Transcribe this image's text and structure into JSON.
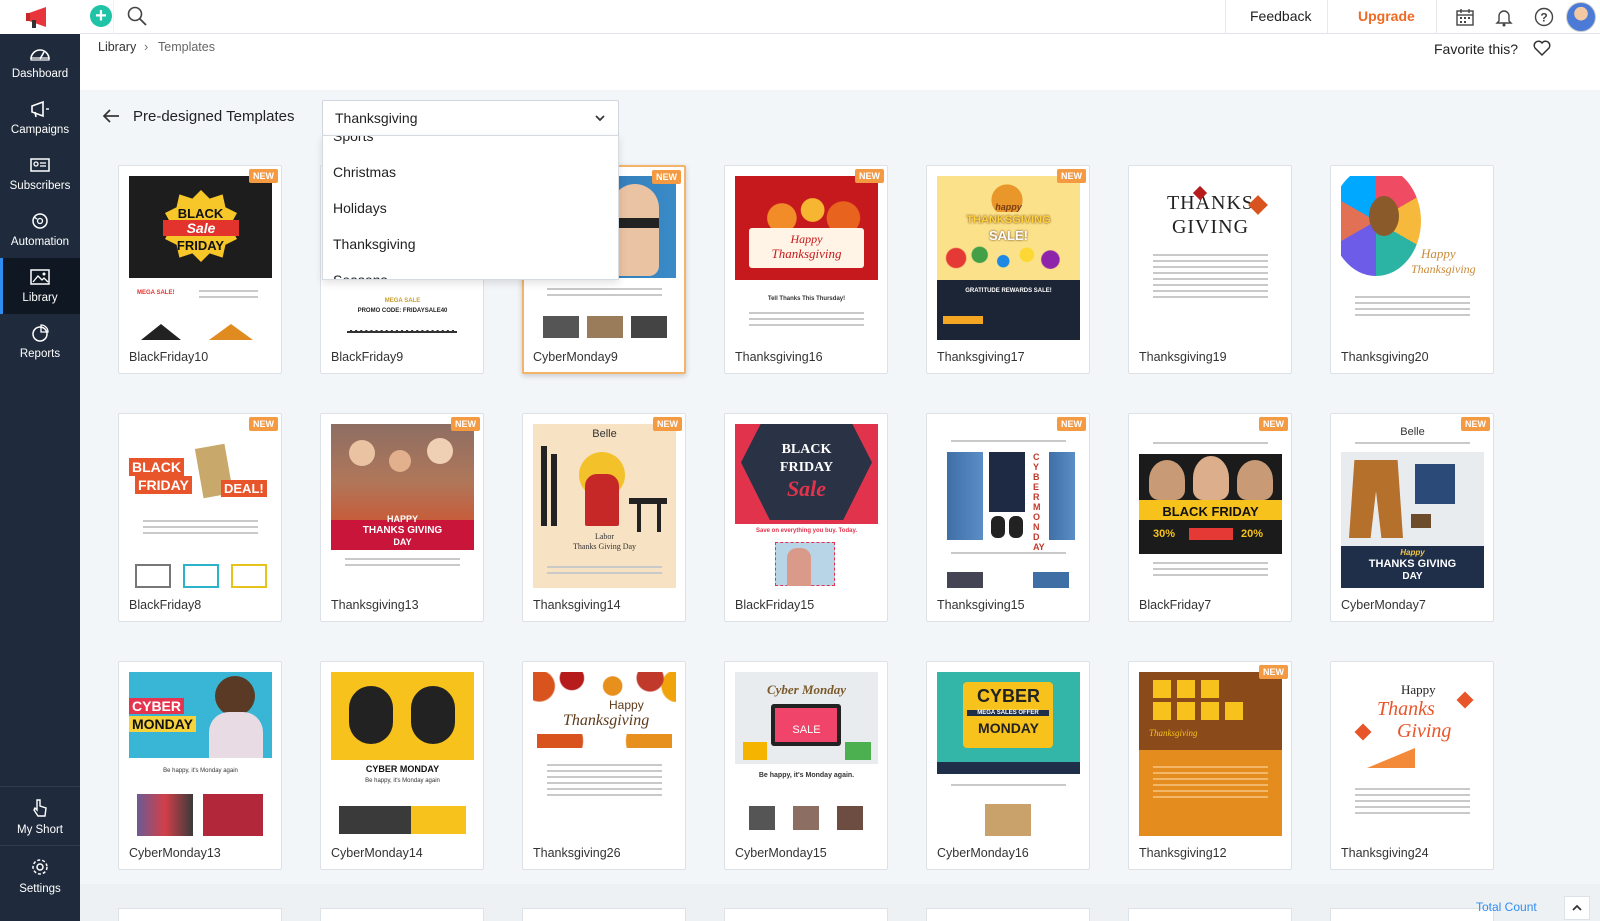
{
  "topbar": {
    "feedback": "Feedback",
    "upgrade": "Upgrade",
    "brand_color": "#e8353b",
    "plus_color": "#20c3a6",
    "accent_color": "#f06a23"
  },
  "sidebar": {
    "items": [
      {
        "label": "Dashboard",
        "icon": "gauge-icon"
      },
      {
        "label": "Campaigns",
        "icon": "megaphone-icon"
      },
      {
        "label": "Subscribers",
        "icon": "id-card-icon"
      },
      {
        "label": "Automation",
        "icon": "automation-icon"
      },
      {
        "label": "Library",
        "icon": "image-icon",
        "active": true
      },
      {
        "label": "Reports",
        "icon": "pie-chart-icon"
      }
    ],
    "bottom": [
      {
        "label": "My Short",
        "icon": "pointer-icon"
      },
      {
        "label": "Settings",
        "icon": "gear-icon"
      }
    ]
  },
  "breadcrumb": {
    "library": "Library",
    "separator": "›",
    "current": "Templates"
  },
  "favorite": "Favorite this?",
  "header": {
    "title": "Pre-designed Templates"
  },
  "dropdown": {
    "value": "Thanksgiving",
    "options": [
      "Sports",
      "Christmas",
      "Holidays",
      "Thanksgiving",
      "Seasons"
    ]
  },
  "badge": "NEW",
  "cards": [
    {
      "name": "BlackFriday10",
      "new": true
    },
    {
      "name": "BlackFriday9",
      "new": false
    },
    {
      "name": "CyberMonday9",
      "new": true
    },
    {
      "name": "Thanksgiving16",
      "new": true
    },
    {
      "name": "Thanksgiving17",
      "new": true
    },
    {
      "name": "Thanksgiving19",
      "new": false
    },
    {
      "name": "Thanksgiving20",
      "new": false
    },
    {
      "name": "BlackFriday8",
      "new": true
    },
    {
      "name": "Thanksgiving13",
      "new": true
    },
    {
      "name": "Thanksgiving14",
      "new": true
    },
    {
      "name": "BlackFriday15",
      "new": false
    },
    {
      "name": "Thanksgiving15",
      "new": true
    },
    {
      "name": "BlackFriday7",
      "new": true
    },
    {
      "name": "CyberMonday7",
      "new": true
    },
    {
      "name": "CyberMonday13",
      "new": false
    },
    {
      "name": "CyberMonday14",
      "new": false
    },
    {
      "name": "Thanksgiving26",
      "new": false
    },
    {
      "name": "CyberMonday15",
      "new": false
    },
    {
      "name": "CyberMonday16",
      "new": false
    },
    {
      "name": "Thanksgiving12",
      "new": true
    },
    {
      "name": "Thanksgiving24",
      "new": false
    }
  ],
  "thumbs": {
    "bf10": {
      "l1": "BLACK",
      "l2": "Sale",
      "l3": "FRIDAY",
      "sub": "MEGA SALE!"
    },
    "bf9": {
      "l1": "MEGA SALE",
      "l2": "PROMO CODE: FRIDAYSALE40"
    },
    "tg16": {
      "l1": "Happy",
      "l2": "Thanksgiving",
      "l3": "Tell Thanks This Thursday!"
    },
    "tg17": {
      "l1": "happy",
      "l2": "THANKSGIVING",
      "l3": "SALE!",
      "l4": "GRATITUDE REWARDS SALE!"
    },
    "tg19": {
      "l1": "THANKS",
      "l2": "GIVING"
    },
    "tg20": {
      "l1": "Happy",
      "l2": "Thanksgiving"
    },
    "bf8": {
      "l1": "BLACK",
      "l2": "FRIDAY",
      "l3": "DEAL!"
    },
    "tg13": {
      "l1": "HAPPY",
      "l2": "THANKS GIVING",
      "l3": "DAY"
    },
    "tg14": {
      "l1": "Belle",
      "l2": "Labor",
      "l3": "Thanks Giving Day"
    },
    "bf15": {
      "l1": "BLACK",
      "l2": "FRIDAY",
      "l3": "Sale",
      "l4": "Save on everything you buy. Today."
    },
    "tg15": {
      "l1": "CYBER MONDAY"
    },
    "bf7": {
      "l1": "BLACK FRIDAY",
      "l2": "30%",
      "l3": "20%"
    },
    "cm7": {
      "l1": "Belle",
      "l2": "Happy",
      "l3": "THANKS GIVING",
      "l4": "DAY"
    },
    "cm13": {
      "l1": "CYBER",
      "l2": "MONDAY",
      "l3": "Be happy, it's Monday again"
    },
    "cm14": {
      "l1": "CYBER MONDAY",
      "l2": "Be happy, it's Monday again"
    },
    "tg26": {
      "l1": "Happy",
      "l2": "Thanksgiving"
    },
    "cm15": {
      "l1": "Cyber Monday",
      "l2": "SALE",
      "l3": "Be happy, it's Monday again."
    },
    "cm16": {
      "l1": "CYBER",
      "l2": "MONDAY",
      "l3": "MEGA SALES OFFER"
    },
    "tg12": {
      "l1": "Thanksgiving"
    },
    "tg24": {
      "l1": "Happy",
      "l2": "Thanks",
      "l3": "Giving"
    }
  },
  "footer": {
    "total_count": "Total Count"
  }
}
